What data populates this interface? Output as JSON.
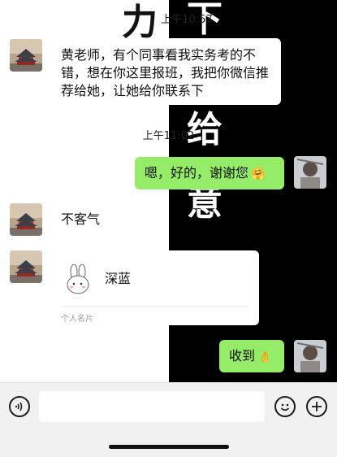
{
  "wallpaper": {
    "chars": [
      "力",
      "下",
      "给",
      "意"
    ]
  },
  "timestamps": [
    "上午10:57",
    "上午11:02"
  ],
  "messages": [
    {
      "from": "them",
      "text": "黄老师，有个同事看我实务考的不错，想在你这里报班，我把你微信推荐给她，让她给你联系下"
    },
    {
      "from": "me",
      "text": "嗯，好的，谢谢您",
      "emoji": "🤗"
    },
    {
      "from": "them",
      "text": "不客气"
    },
    {
      "from": "them",
      "type": "contact_card",
      "name": "深蓝",
      "label": "个人名片"
    },
    {
      "from": "me",
      "text": "收到",
      "emoji": "👌"
    }
  ],
  "input_bar": {
    "value": ""
  },
  "icons": [
    "voice-icon",
    "emoji-icon",
    "plus-icon"
  ]
}
